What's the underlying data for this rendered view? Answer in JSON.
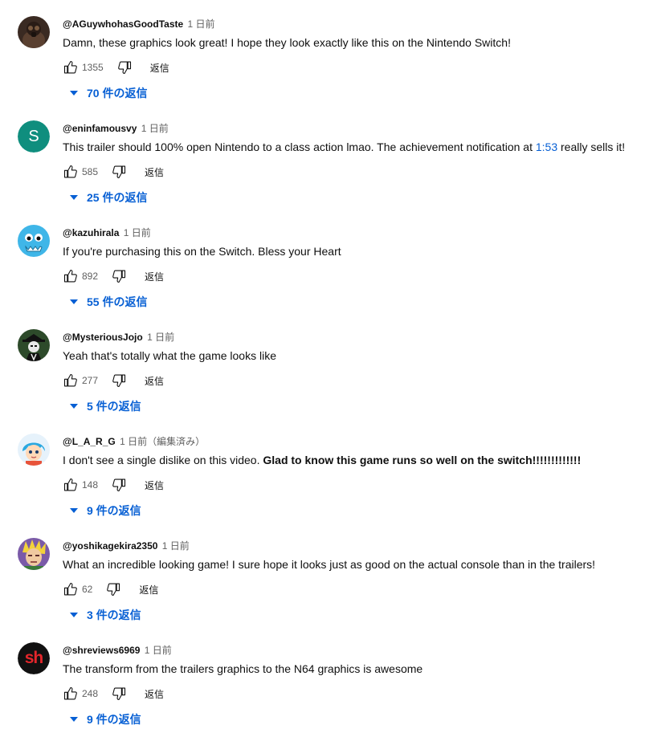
{
  "reply_label": "返信",
  "accent_color": "#065fd4",
  "comments": [
    {
      "author": "@AGuywhohasGoodTaste",
      "time": "1 日前",
      "edited": "",
      "avatar_icon": "gas-mask-person-avatar",
      "text": {
        "before": "Damn, these graphics look great! I hope they look exactly like this on the Nintendo Switch!",
        "link": "",
        "after": "",
        "bold": ""
      },
      "likes": "1355",
      "replies": "70 件の返信"
    },
    {
      "author": "@eninfamousvy",
      "time": "1 日前",
      "edited": "",
      "avatar_icon": "letter-s-avatar",
      "avatar_letter": "S",
      "avatar_color": "#0f8e7e",
      "text": {
        "before": "This trailer should 100% open Nintendo to a class action lmao. The achievement notification at ",
        "link": "1:53",
        "after": " really sells it!",
        "bold": ""
      },
      "likes": "585",
      "replies": "25 件の返信"
    },
    {
      "author": "@kazuhirala",
      "time": "1 日前",
      "edited": "",
      "avatar_icon": "blue-monster-avatar",
      "text": {
        "before": "If you're purchasing this on the Switch. Bless your Heart",
        "link": "",
        "after": "",
        "bold": ""
      },
      "likes": "892",
      "replies": "55 件の返信"
    },
    {
      "author": "@MysteriousJojo",
      "time": "1 日前",
      "edited": "",
      "avatar_icon": "hat-figure-avatar",
      "text": {
        "before": "Yeah that's totally what the game looks like",
        "link": "",
        "after": "",
        "bold": ""
      },
      "likes": "277",
      "replies": "5 件の返信"
    },
    {
      "author": "@L_A_R_G",
      "time": "1 日前",
      "edited": "（編集済み）",
      "avatar_icon": "anime-boy-avatar",
      "text": {
        "before": "I don't see a single dislike on this video. ",
        "link": "",
        "after": "",
        "bold": "Glad to know this game runs so well on the switch!!!!!!!!!!!!!"
      },
      "likes": "148",
      "replies": "9 件の返信"
    },
    {
      "author": "@yoshikagekira2350",
      "time": "1 日前",
      "edited": "",
      "avatar_icon": "anime-character-avatar",
      "text": {
        "before": "What an incredible looking game! I sure hope it looks just as good on the actual console than in the trailers!",
        "link": "",
        "after": "",
        "bold": ""
      },
      "likes": "62",
      "replies": "3 件の返信"
    },
    {
      "author": "@shreviews6969",
      "time": "1 日前",
      "edited": "",
      "avatar_icon": "sh-logo-avatar",
      "avatar_letter": "sh",
      "text": {
        "before": "The transform from the trailers graphics to the N64 graphics is awesome",
        "link": "",
        "after": "",
        "bold": ""
      },
      "likes": "248",
      "replies": "9 件の返信"
    }
  ]
}
